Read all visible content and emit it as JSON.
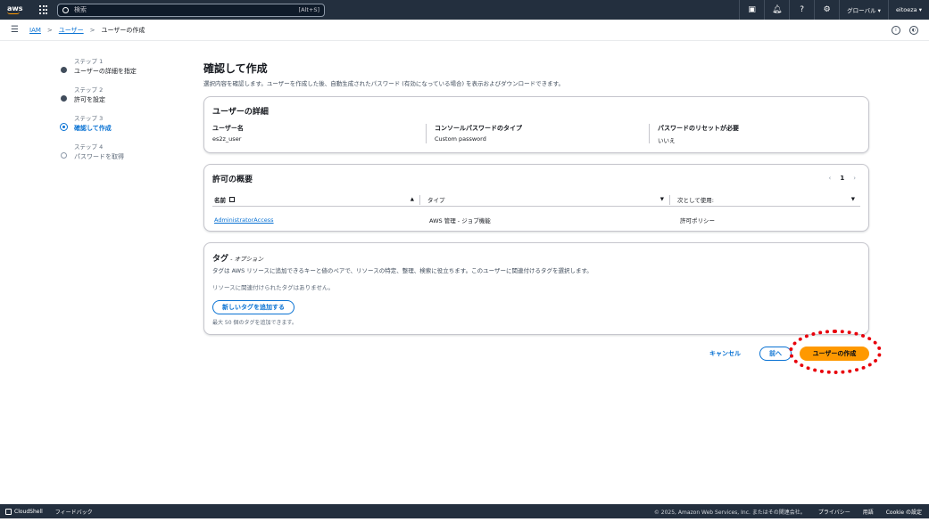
{
  "topbar": {
    "logo": "aws",
    "search_placeholder": "検索",
    "search_shortcut": "[Alt+S]",
    "region": "グローバル ▾",
    "user": "eitoeza ▾"
  },
  "breadcrumb": {
    "items": [
      "IAM",
      "ユーザー",
      "ユーザーの作成"
    ],
    "separator": ">"
  },
  "steps": [
    {
      "label": "ステップ 1",
      "title": "ユーザーの詳細を指定"
    },
    {
      "label": "ステップ 2",
      "title": "許可を設定"
    },
    {
      "label": "ステップ 3",
      "title": "確認して作成"
    },
    {
      "label": "ステップ 4",
      "title": "パスワードを取得"
    }
  ],
  "page": {
    "title": "確認して作成",
    "description": "選択内容を確認します。ユーザーを作成した後、自動生成されたパスワード (有効になっている場合) を表示およびダウンロードできます。"
  },
  "user_details": {
    "title": "ユーザーの詳細",
    "username_label": "ユーザー名",
    "username_value": "es2z_user",
    "password_type_label": "コンソールパスワードのタイプ",
    "password_type_value": "Custom password",
    "reset_label": "パスワードのリセットが必要",
    "reset_value": "いいえ"
  },
  "permissions": {
    "title": "許可の概要",
    "page_number": "1",
    "prev": "‹",
    "next": "›",
    "columns": [
      "名前",
      "タイプ",
      "次として使用:"
    ],
    "rows": [
      {
        "name": "AdministratorAccess",
        "type": "AWS 管理 - ジョブ機能",
        "used_as": "許可ポリシー"
      }
    ]
  },
  "tags": {
    "title": "タグ",
    "optional": " - オプション",
    "description": "タグは AWS リソースに追加できるキーと値のペアで、リソースの特定、整理、検索に役立ちます。このユーザーに関連付けるタグを選択します。",
    "empty_text": "リソースに関連付けられたタグはありません。",
    "add_button": "新しいタグを追加する",
    "limit_text": "最大 50 個のタグを追加できます。"
  },
  "actions": {
    "cancel": "キャンセル",
    "previous": "前へ",
    "create": "ユーザーの作成"
  },
  "footer": {
    "cloudshell": "CloudShell",
    "feedback": "フィードバック",
    "copyright": "© 2025, Amazon Web Services, Inc. またはその関連会社。",
    "privacy": "プライバシー",
    "terms": "用語",
    "cookie": "Cookie の設定"
  },
  "colors": {
    "topbar": "#232f3e",
    "link": "#0972d3",
    "primary_button": "#ff9900",
    "highlight": "#e8000b"
  }
}
